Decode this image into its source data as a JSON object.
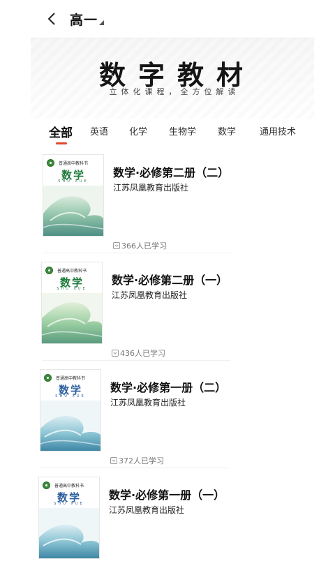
{
  "header": {
    "back_icon": "chevron-left-icon",
    "grade": "高一",
    "caret_icon": "caret-down-icon"
  },
  "banner": {
    "title": "数字教材",
    "subtitle": "立体化课程，全方位解读"
  },
  "tabs": [
    {
      "label": "全部",
      "active": true
    },
    {
      "label": "英语",
      "active": false
    },
    {
      "label": "化学",
      "active": false
    },
    {
      "label": "生物学",
      "active": false
    },
    {
      "label": "数学",
      "active": false
    },
    {
      "label": "通用技术",
      "active": false
    }
  ],
  "accent_color": "#e5452b",
  "books": [
    {
      "title": "数学·必修第二册（二）",
      "publisher": "江苏凤凰教育出版社",
      "learners": "366人已学习",
      "cover_title": "数学",
      "cover_pinyin": "SHU XUE",
      "cover_series": "普通高中教科书"
    },
    {
      "title": "数学·必修第二册（一）",
      "publisher": "江苏凤凰教育出版社",
      "learners": "436人已学习",
      "cover_title": "数学",
      "cover_pinyin": "SHU XUE",
      "cover_series": "普通高中教科书"
    },
    {
      "title": "数学·必修第一册（二）",
      "publisher": "江苏凤凰教育出版社",
      "learners": "372人已学习",
      "cover_title": "数学",
      "cover_pinyin": "SHU XUE",
      "cover_series": "普通高中教科书"
    },
    {
      "title": "数学·必修第一册（一）",
      "publisher": "江苏凤凰教育出版社",
      "learners": "",
      "cover_title": "数学",
      "cover_pinyin": "SHU XUE",
      "cover_series": "普通高中教科书"
    }
  ]
}
